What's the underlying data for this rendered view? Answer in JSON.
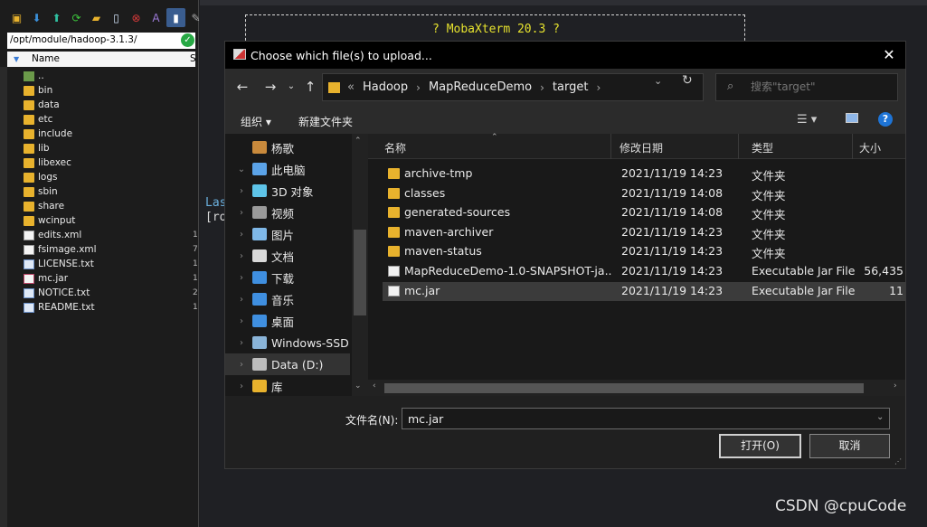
{
  "left_panel": {
    "path": "/opt/module/hadoop-3.1.3/",
    "column_name": "Name",
    "column_size": "S",
    "items": [
      {
        "name": "..",
        "type": "up",
        "size": ""
      },
      {
        "name": "bin",
        "type": "folder",
        "size": ""
      },
      {
        "name": "data",
        "type": "folder",
        "size": ""
      },
      {
        "name": "etc",
        "type": "folder",
        "size": ""
      },
      {
        "name": "include",
        "type": "folder",
        "size": ""
      },
      {
        "name": "lib",
        "type": "folder",
        "size": ""
      },
      {
        "name": "libexec",
        "type": "folder",
        "size": ""
      },
      {
        "name": "logs",
        "type": "folder",
        "size": ""
      },
      {
        "name": "sbin",
        "type": "folder",
        "size": ""
      },
      {
        "name": "share",
        "type": "folder",
        "size": ""
      },
      {
        "name": "wcinput",
        "type": "folder",
        "size": ""
      },
      {
        "name": "edits.xml",
        "type": "file",
        "size": "1"
      },
      {
        "name": "fsimage.xml",
        "type": "file",
        "size": "7"
      },
      {
        "name": "LICENSE.txt",
        "type": "txt",
        "size": "1"
      },
      {
        "name": "mc.jar",
        "type": "jar",
        "size": "1"
      },
      {
        "name": "NOTICE.txt",
        "type": "txt",
        "size": "2"
      },
      {
        "name": "README.txt",
        "type": "txt",
        "size": "1"
      }
    ]
  },
  "terminal": {
    "banner_title": "? MobaXterm 20.3 ?",
    "line_last": "Las",
    "line_prompt": "[ro"
  },
  "dialog": {
    "title": "Choose which file(s) to upload...",
    "breadcrumbs": [
      "Hadoop",
      "MapReduceDemo",
      "target"
    ],
    "addr_prefix": "«",
    "search_placeholder": "搜索\"target\"",
    "organize_label": "组织 ▾",
    "new_folder_label": "新建文件夹",
    "tree": [
      {
        "label": "杨歌",
        "icon": "user-folder-icon",
        "color": "#c98a3c",
        "chev": ""
      },
      {
        "label": "此电脑",
        "icon": "computer-icon",
        "color": "#5ba3e8",
        "chev": "⌄"
      },
      {
        "label": "3D 对象",
        "icon": "3d-objects-icon",
        "color": "#5ec4e8",
        "chev": "›"
      },
      {
        "label": "视频",
        "icon": "video-icon",
        "color": "#9a9a9a",
        "chev": "›"
      },
      {
        "label": "图片",
        "icon": "pictures-icon",
        "color": "#7fb8e8",
        "chev": "›"
      },
      {
        "label": "文档",
        "icon": "documents-icon",
        "color": "#d9d9d9",
        "chev": "›"
      },
      {
        "label": "下载",
        "icon": "downloads-icon",
        "color": "#3f8fe0",
        "chev": "›"
      },
      {
        "label": "音乐",
        "icon": "music-icon",
        "color": "#3f8fe0",
        "chev": "›"
      },
      {
        "label": "桌面",
        "icon": "desktop-icon",
        "color": "#3f8fe0",
        "chev": "›"
      },
      {
        "label": "Windows-SSD",
        "icon": "drive-icon",
        "color": "#8ab4d8",
        "chev": "›"
      },
      {
        "label": "Data (D:)",
        "icon": "drive-icon",
        "color": "#bdbdbd",
        "chev": "›"
      },
      {
        "label": "库",
        "icon": "library-icon",
        "color": "#e8b22d",
        "chev": "›"
      }
    ],
    "columns": {
      "name": "名称",
      "date": "修改日期",
      "type": "类型",
      "size": "大小"
    },
    "files": [
      {
        "name": "archive-tmp",
        "date": "2021/11/19 14:23",
        "type": "文件夹",
        "size": "",
        "kind": "folder"
      },
      {
        "name": "classes",
        "date": "2021/11/19 14:08",
        "type": "文件夹",
        "size": "",
        "kind": "folder"
      },
      {
        "name": "generated-sources",
        "date": "2021/11/19 14:08",
        "type": "文件夹",
        "size": "",
        "kind": "folder"
      },
      {
        "name": "maven-archiver",
        "date": "2021/11/19 14:23",
        "type": "文件夹",
        "size": "",
        "kind": "folder"
      },
      {
        "name": "maven-status",
        "date": "2021/11/19 14:23",
        "type": "文件夹",
        "size": "",
        "kind": "folder"
      },
      {
        "name": "MapReduceDemo-1.0-SNAPSHOT-ja...",
        "date": "2021/11/19 14:23",
        "type": "Executable Jar File",
        "size": "56,435",
        "kind": "jar"
      },
      {
        "name": "mc.jar",
        "date": "2021/11/19 14:23",
        "type": "Executable Jar File",
        "size": "11",
        "kind": "jar"
      }
    ],
    "selected_index": 6,
    "filename_label": "文件名(N):",
    "filename_value": "mc.jar",
    "open_label": "打开(O)",
    "cancel_label": "取消"
  },
  "watermark": "CSDN @cpuCode"
}
